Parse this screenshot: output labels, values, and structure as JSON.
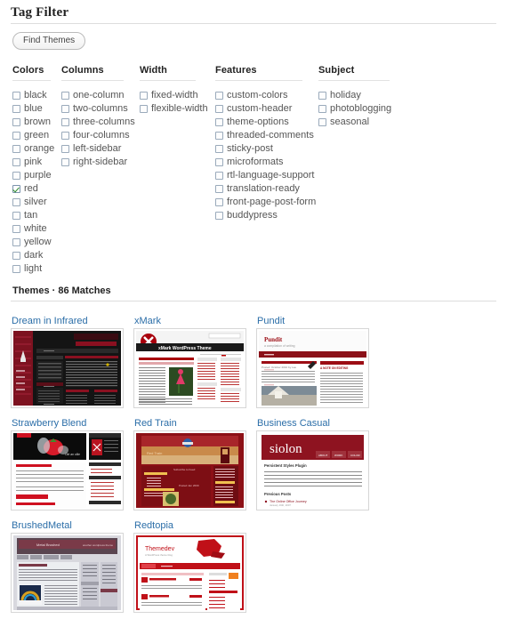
{
  "filter": {
    "title": "Tag Filter",
    "find_button": "Find Themes",
    "columns": [
      {
        "heading": "Colors",
        "options": [
          {
            "label": "black",
            "checked": false
          },
          {
            "label": "blue",
            "checked": false
          },
          {
            "label": "brown",
            "checked": false
          },
          {
            "label": "green",
            "checked": false
          },
          {
            "label": "orange",
            "checked": false
          },
          {
            "label": "pink",
            "checked": false
          },
          {
            "label": "purple",
            "checked": false
          },
          {
            "label": "red",
            "checked": true
          },
          {
            "label": "silver",
            "checked": false
          },
          {
            "label": "tan",
            "checked": false
          },
          {
            "label": "white",
            "checked": false
          },
          {
            "label": "yellow",
            "checked": false
          },
          {
            "label": "dark",
            "checked": false
          },
          {
            "label": "light",
            "checked": false
          }
        ]
      },
      {
        "heading": "Columns",
        "options": [
          {
            "label": "one-column",
            "checked": false
          },
          {
            "label": "two-columns",
            "checked": false
          },
          {
            "label": "three-columns",
            "checked": false
          },
          {
            "label": "four-columns",
            "checked": false
          },
          {
            "label": "left-sidebar",
            "checked": false
          },
          {
            "label": "right-sidebar",
            "checked": false
          }
        ]
      },
      {
        "heading": "Width",
        "options": [
          {
            "label": "fixed-width",
            "checked": false
          },
          {
            "label": "flexible-width",
            "checked": false
          }
        ]
      },
      {
        "heading": "Features",
        "options": [
          {
            "label": "custom-colors",
            "checked": false
          },
          {
            "label": "custom-header",
            "checked": false
          },
          {
            "label": "theme-options",
            "checked": false
          },
          {
            "label": "threaded-comments",
            "checked": false
          },
          {
            "label": "sticky-post",
            "checked": false
          },
          {
            "label": "microformats",
            "checked": false
          },
          {
            "label": "rtl-language-support",
            "checked": false
          },
          {
            "label": "translation-ready",
            "checked": false
          },
          {
            "label": "front-page-post-form",
            "checked": false
          },
          {
            "label": "buddypress",
            "checked": false
          }
        ]
      },
      {
        "heading": "Subject",
        "options": [
          {
            "label": "holiday",
            "checked": false
          },
          {
            "label": "photoblogging",
            "checked": false
          },
          {
            "label": "seasonal",
            "checked": false
          }
        ]
      }
    ]
  },
  "results": {
    "heading": "Themes · 86 Matches",
    "match_count": 86,
    "themes": [
      {
        "name": "Dream in Infrared",
        "style": "dream"
      },
      {
        "name": "xMark",
        "style": "xmark"
      },
      {
        "name": "Pundit",
        "style": "pundit"
      },
      {
        "name": "Strawberry Blend",
        "style": "strawberry"
      },
      {
        "name": "Red Train",
        "style": "redtrain"
      },
      {
        "name": "Business Casual",
        "style": "business"
      },
      {
        "name": "BrushedMetal",
        "style": "brushed"
      },
      {
        "name": "Redtopia",
        "style": "redtopia"
      }
    ]
  },
  "colors": {
    "link": "#2b6ea8",
    "accent_red": "#9c0d14",
    "text": "#555555",
    "rule": "#dddddd"
  }
}
